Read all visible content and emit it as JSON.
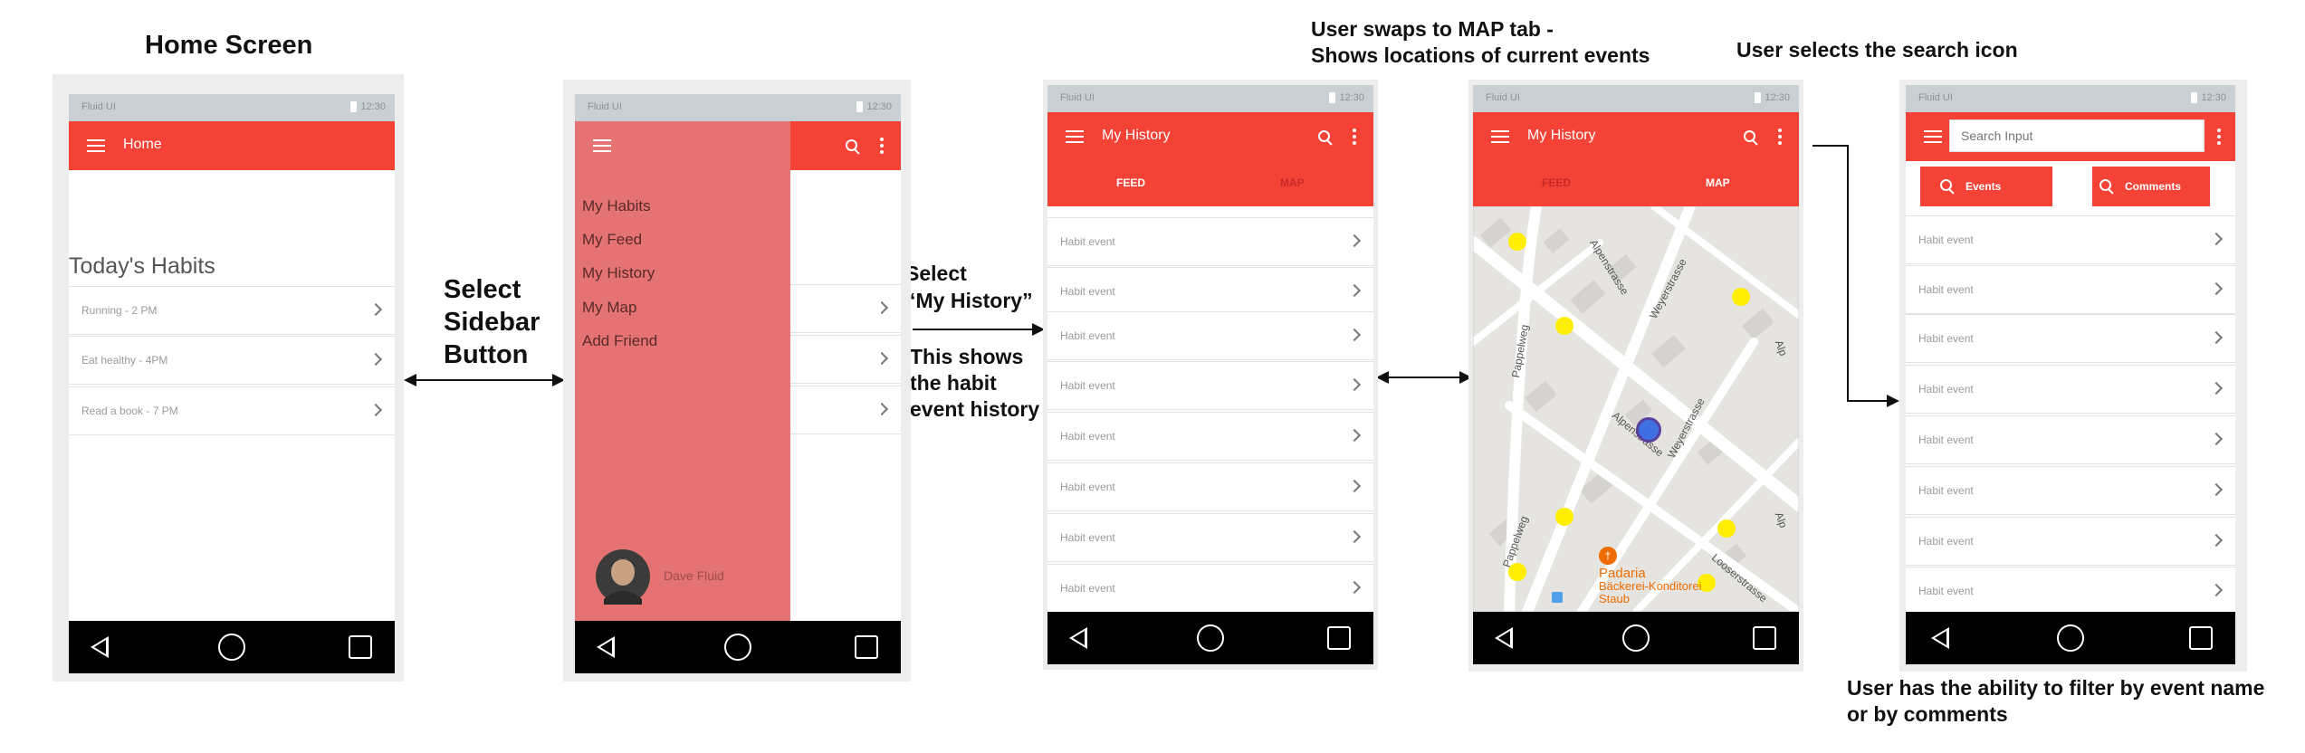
{
  "captions": {
    "home_screen": "Home Screen",
    "select_sidebar": [
      "Select",
      "Sidebar",
      "Button"
    ],
    "select_history": [
      "Select",
      "“My History”"
    ],
    "history_explain": [
      "This shows",
      "the habit",
      "event history"
    ],
    "map_swap": [
      "User swaps to MAP tab -",
      "Shows locations of current events"
    ],
    "search_select": "User selects the search icon",
    "filter_note": [
      "User has the ability to filter by event name",
      "or by comments"
    ]
  },
  "status_bar": {
    "carrier": "Fluid UI",
    "time": "12:30"
  },
  "screen_home": {
    "title": "Home",
    "section_heading": "Today's Habits",
    "habits": [
      {
        "label": "Running - 2 PM"
      },
      {
        "label": "Eat healthy - 4PM"
      },
      {
        "label": "Read a book - 7 PM"
      }
    ]
  },
  "screen_sidebar": {
    "menu_items": [
      {
        "label": "My Habits"
      },
      {
        "label": "My Feed"
      },
      {
        "label": "My History"
      },
      {
        "label": "My Map"
      },
      {
        "label": "Add Friend"
      }
    ],
    "user_name": "Dave Fluid"
  },
  "screen_history": {
    "title": "My History",
    "tabs": [
      {
        "label": "FEED",
        "active": true
      },
      {
        "label": "MAP",
        "active": false
      }
    ],
    "events": [
      {
        "label": "Habit event"
      },
      {
        "label": "Habit event"
      },
      {
        "label": "Habit event"
      },
      {
        "label": "Habit event"
      },
      {
        "label": "Habit event"
      },
      {
        "label": "Habit event"
      },
      {
        "label": "Habit event"
      },
      {
        "label": "Habit event"
      }
    ]
  },
  "screen_map": {
    "title": "My History",
    "tabs": [
      {
        "label": "FEED",
        "active": false
      },
      {
        "label": "MAP",
        "active": true
      }
    ],
    "street_labels": [
      "Alpenstrasse",
      "Weyerstrasse",
      "Pappelweg",
      "Looserstrasse",
      "Alp",
      "Alp"
    ],
    "poi_name": [
      "Padaria",
      "Bäckerei-Konditorei",
      "Staub"
    ]
  },
  "screen_search": {
    "search_placeholder": "Search Input",
    "filter_buttons": [
      {
        "label": "Events"
      },
      {
        "label": "Comments"
      }
    ],
    "events": [
      {
        "label": "Habit event"
      },
      {
        "label": "Habit event"
      },
      {
        "label": "Habit event"
      },
      {
        "label": "Habit event"
      },
      {
        "label": "Habit event"
      },
      {
        "label": "Habit event"
      },
      {
        "label": "Habit event"
      },
      {
        "label": "Habit event"
      }
    ]
  },
  "colors": {
    "app_bar": "#f44336",
    "sidebar_overlay": "#e57373",
    "inactive_tab_text": "#c62828",
    "nav_bar": "#000000",
    "map_event_marker": "#ffee00",
    "map_user_marker": "#3f6fe0",
    "poi": "#ef6c00"
  },
  "icons": [
    "hamburger-icon",
    "search-icon",
    "overflow-menu-icon",
    "chevron-right-icon",
    "back-nav-icon",
    "home-nav-icon",
    "recents-nav-icon",
    "battery-icon",
    "restaurant-icon",
    "bus-stop-icon"
  ]
}
